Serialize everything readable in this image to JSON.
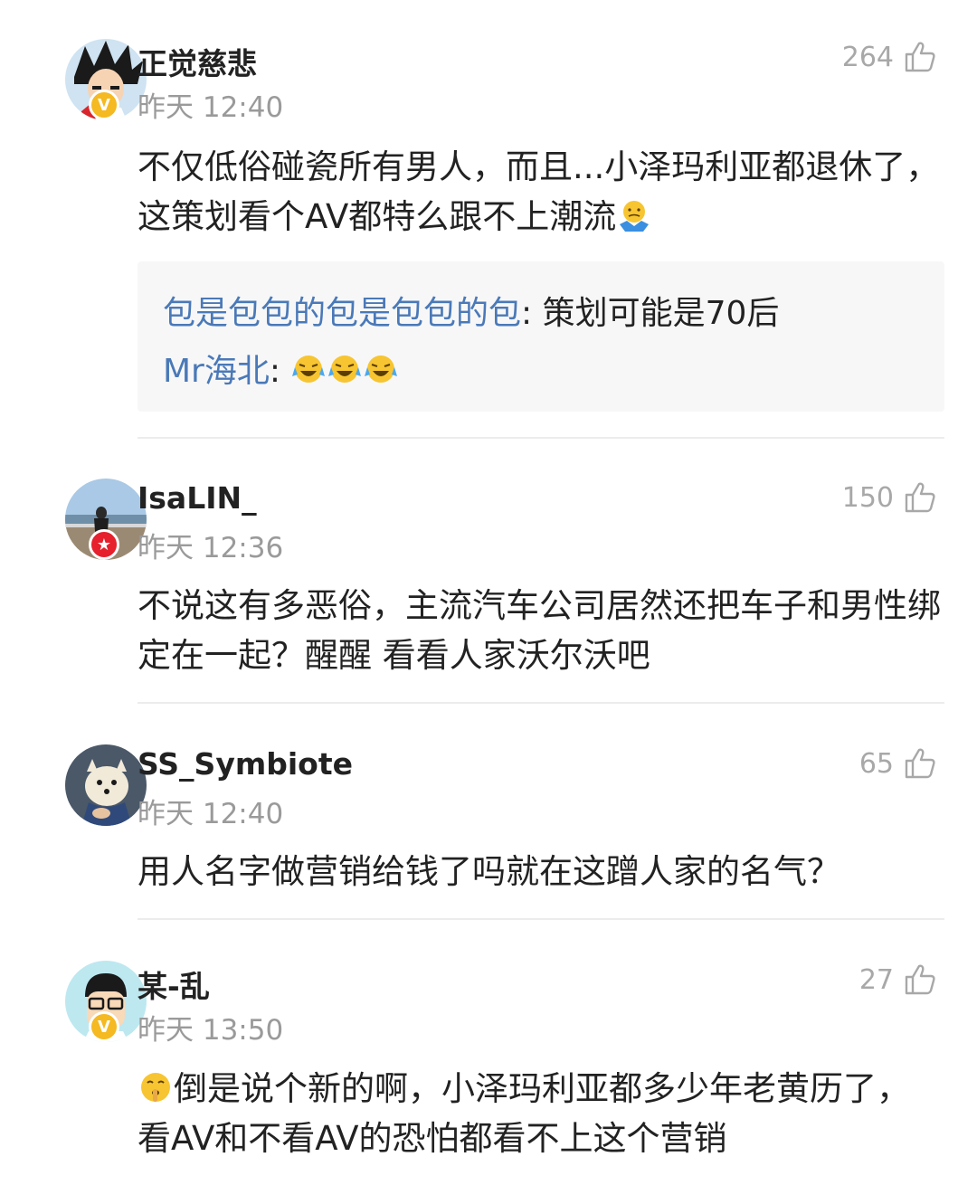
{
  "comments": [
    {
      "user": "正觉慈悲",
      "time": "昨天 12:40",
      "likes": "264",
      "badge": "V",
      "text": "不仅低俗碰瓷所有男人，而且...小泽玛利亚都退休了，这策划看个AV都特么跟不上潮流",
      "emoji_after": "shrug-emoji",
      "replies": [
        {
          "name": "包是包包的包是包包的包",
          "sep": ": ",
          "text": "策划可能是70后"
        },
        {
          "name": "Mr海北",
          "sep": ": ",
          "text": "",
          "emoji": "laugh-cry-emoji x3"
        }
      ]
    },
    {
      "user": "IsaLIN_",
      "time": "昨天 12:36",
      "likes": "150",
      "badge": "★",
      "text": "不说这有多恶俗，主流汽车公司居然还把车子和男性绑定在一起？醒醒 看看人家沃尔沃吧"
    },
    {
      "user": "SS_Symbiote",
      "time": "昨天 12:40",
      "likes": "65",
      "text": "用人名字做营销给钱了吗就在这蹭人家的名气？"
    },
    {
      "user": "某-乱",
      "time": "昨天 13:50",
      "likes": "27",
      "badge": "V",
      "emoji_before": "shush-emoji",
      "text": "倒是说个新的啊，小泽玛利亚都多少年老黄历了，看AV和不看AV的恐怕都看不上这个营销"
    }
  ],
  "colors": {
    "link": "#4a79b8",
    "meta": "#9a9a9a",
    "badge_gold": "#f5b921",
    "badge_red": "#e6202c"
  }
}
